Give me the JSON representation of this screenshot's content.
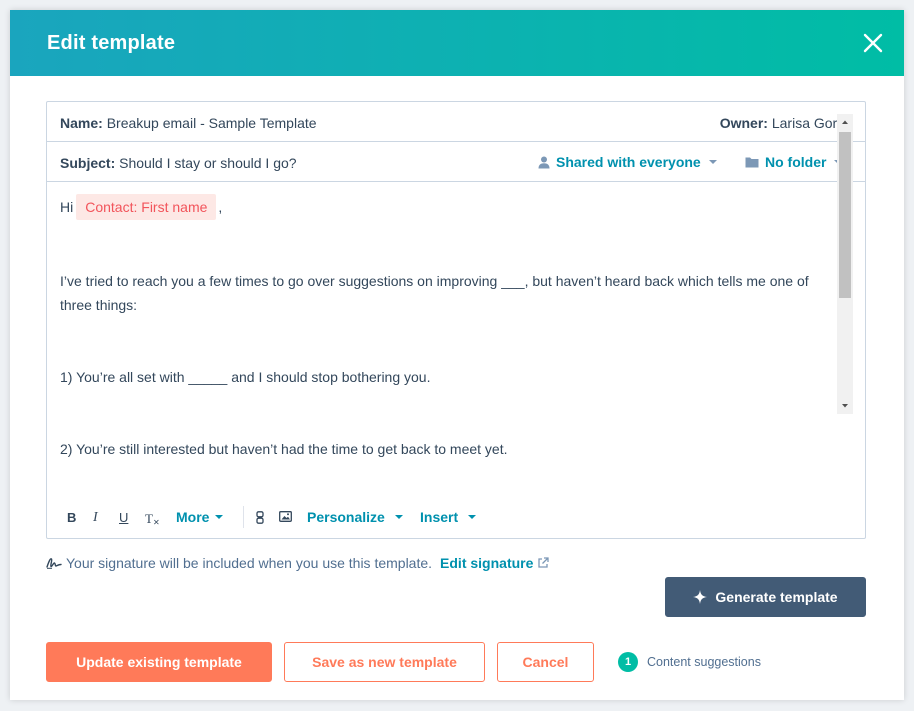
{
  "header": {
    "title": "Edit template",
    "close_icon": "close-icon"
  },
  "template": {
    "name_label": "Name:",
    "name_value": "Breakup email - Sample Template",
    "owner_label": "Owner:",
    "owner_value": "Larisa Gorn",
    "subject_label": "Subject:",
    "subject_value": "Should I stay or should I go?",
    "shared_label": "Shared with everyone",
    "folder_label": "No folder"
  },
  "body": {
    "greeting": "Hi",
    "token": "Contact: First name",
    "greeting_end": ",",
    "para1_line1": "I’ve tried to reach you a few times to go over suggestions on improving ___, but haven’t heard back which tells me one of",
    "para1_line2": "three things:",
    "item1": "1) You’re all set with _____ and I should stop bothering you.",
    "item2": "2) You’re still interested but haven’t had the time to get back to meet yet."
  },
  "toolbar": {
    "bold": "B",
    "italic": "I",
    "underline": "U",
    "clear_format": "T",
    "more": "More",
    "personalize": "Personalize",
    "insert": "Insert"
  },
  "signature": {
    "text": "Your signature will be included when you use this template.",
    "link": "Edit signature"
  },
  "actions": {
    "generate": "Generate template",
    "update": "Update existing template",
    "save_new": "Save as new template",
    "cancel": "Cancel",
    "suggestions_count": "1",
    "suggestions_label": "Content suggestions"
  },
  "colors": {
    "header_start": "#1aa5be",
    "header_end": "#00bda5",
    "primary": "#ff7a59",
    "link": "#0091ae",
    "dark_button": "#425b76",
    "token_bg": "#fde8e5",
    "token_text": "#f2545b"
  }
}
